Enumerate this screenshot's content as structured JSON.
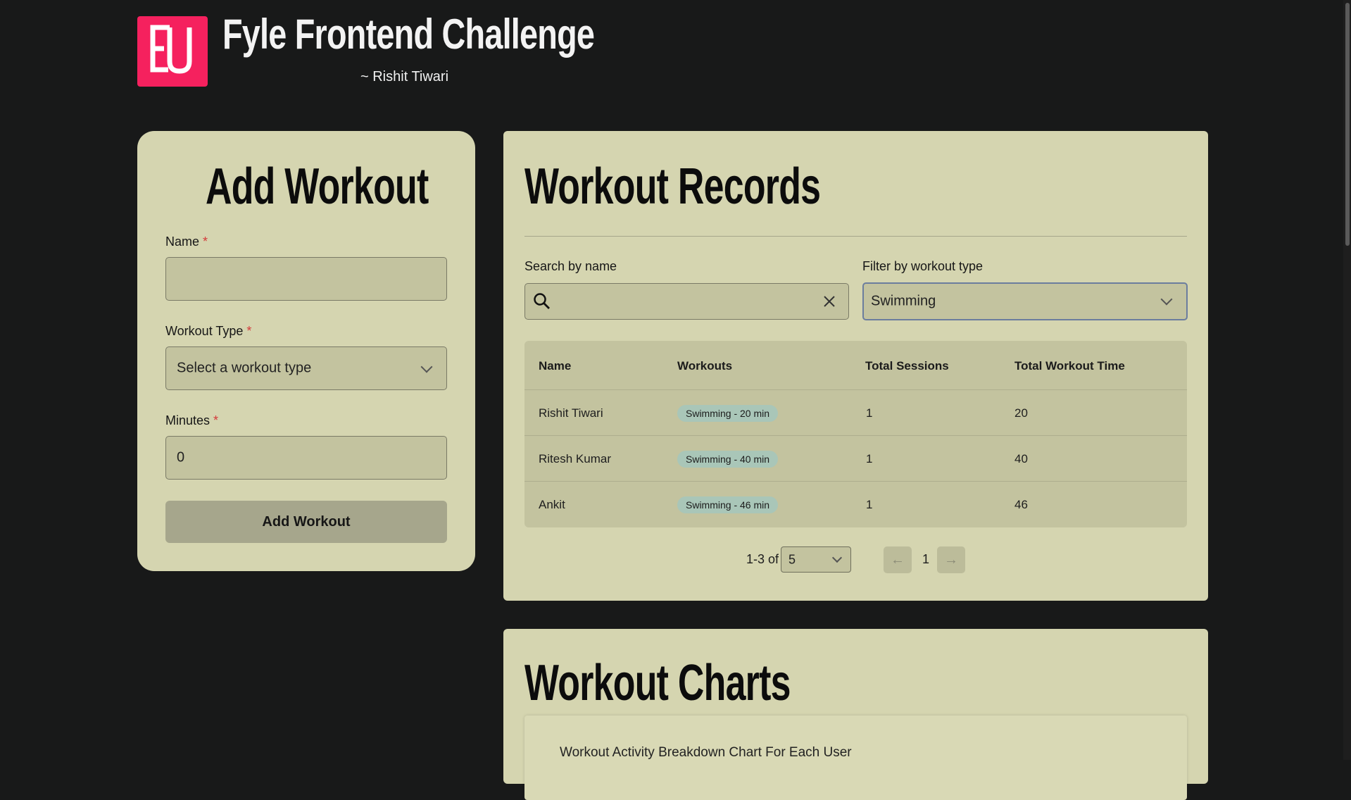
{
  "header": {
    "title": "Fyle Frontend Challenge",
    "author": "~ Rishit Tiwari",
    "logo_color": "#f5215e"
  },
  "add_workout": {
    "title": "Add Workout",
    "name_label": "Name",
    "name_value": "",
    "workout_type_label": "Workout Type",
    "workout_type_placeholder": "Select a workout type",
    "minutes_label": "Minutes",
    "minutes_value": "0",
    "required_mark": "*",
    "submit_label": "Add Workout"
  },
  "records": {
    "title": "Workout Records",
    "search_label": "Search by name",
    "search_value": "",
    "filter_label": "Filter by workout type",
    "filter_value": "Swimming",
    "columns": [
      "Name",
      "Workouts",
      "Total Sessions",
      "Total Workout Time"
    ],
    "rows": [
      {
        "name": "Rishit Tiwari",
        "workout": "Swimming - 20 min",
        "sessions": "1",
        "time": "20"
      },
      {
        "name": "Ritesh Kumar",
        "workout": "Swimming - 40 min",
        "sessions": "1",
        "time": "40"
      },
      {
        "name": "Ankit",
        "workout": "Swimming - 46 min",
        "sessions": "1",
        "time": "46"
      }
    ],
    "pagination": {
      "range": "1-3 of 3",
      "page_size": "5",
      "current_page": "1",
      "prev_icon": "arrow-left-icon",
      "next_icon": "arrow-right-icon"
    }
  },
  "charts": {
    "title": "Workout Charts",
    "chart_title": "Workout Activity Breakdown Chart For Each User"
  },
  "colors": {
    "background": "#181919",
    "card": "#d5d5b0",
    "field": "#c3c39f",
    "chip": "#a9c6b8",
    "button": "#a6a68c"
  }
}
